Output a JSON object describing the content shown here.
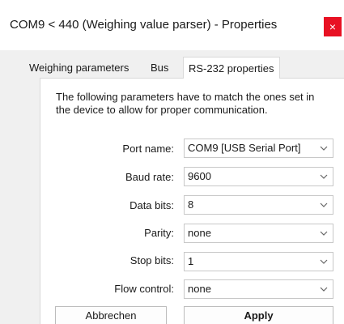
{
  "window": {
    "title": "COM9 < 440 (Weighing value parser) - Properties",
    "close_glyph": "×"
  },
  "tabs": [
    {
      "label": "Weighing parameters",
      "active": false
    },
    {
      "label": "Bus",
      "active": false
    },
    {
      "label": "RS-232 properties",
      "active": true
    }
  ],
  "description": "The following parameters have to match the ones set in the device to allow for proper communication.",
  "fields": {
    "port_name": {
      "label": "Port name:",
      "value": "COM9 [USB Serial Port]"
    },
    "baud_rate": {
      "label": "Baud rate:",
      "value": "9600"
    },
    "data_bits": {
      "label": "Data bits:",
      "value": "8"
    },
    "parity": {
      "label": "Parity:",
      "value": "none"
    },
    "stop_bits": {
      "label": "Stop bits:",
      "value": "1"
    },
    "flow_control": {
      "label": "Flow control:",
      "value": "none"
    }
  },
  "buttons": {
    "cancel": "Abbrechen",
    "apply": "Apply"
  },
  "colors": {
    "close_button": "#e81123",
    "dialog_background": "#f0f0f0",
    "panel_background": "#ffffff"
  }
}
